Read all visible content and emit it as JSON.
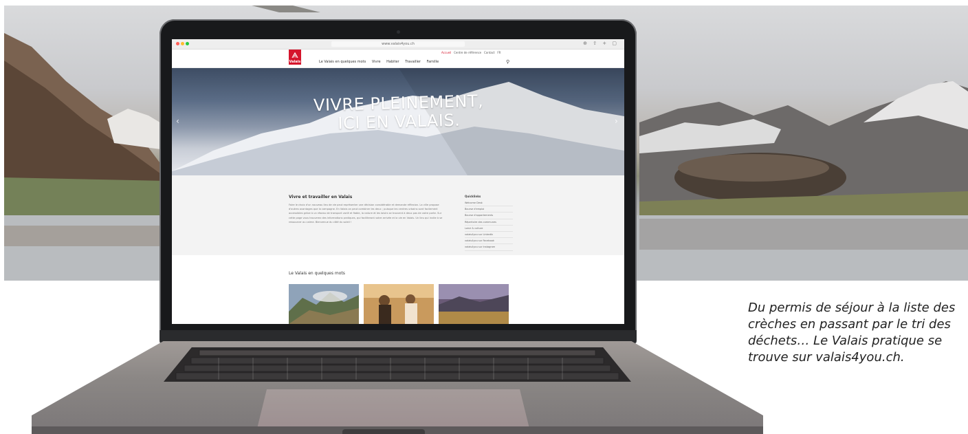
{
  "caption": {
    "text": "Du permis de séjour à la liste des\ncrèches en passant par le tri des\ndéchets… Le Valais pratique se\ntrouve sur valais4you.ch."
  },
  "browser": {
    "url": "www.valais4you.ch"
  },
  "site": {
    "logo_text": "Valais",
    "util_links": [
      "Accueil",
      "Centre de référence",
      "Contact",
      "FR"
    ],
    "nav": [
      "Le Valais en quelques mots",
      "Vivre",
      "Habiter",
      "Travailler",
      "Famille"
    ],
    "hero_title": "VIVRE PLEINEMENT,\nICI EN VALAIS.",
    "intro_heading": "Vivre et travailler en Valais",
    "intro_text": "Faire le choix d'un nouveau lieu de vie peut représenter une décision considérable et demande réflexion. La ville propose d'autres avantages que la campagne. En Valais on peut combiner les deux ; puisque les centres urbains sont facilement accessibles grâce à un réseau de transport varié et fiable, la nature et les loisirs se trouvent à deux pas de votre porte. Sur cette page vous trouverez des informations pratiques, qui faciliteront votre arrivée et la vie en Valais. Un lieu qui invite à se ressourcer au calme. Bienvenue du côté du soleil !",
    "quicklinks_title": "Quicklinks",
    "quicklinks": [
      "Welcome Desk",
      "Bourse d'emploi",
      "Bourse d'appartements",
      "Répertoire des communes",
      "Loisir & culture",
      "valais4you sur LinkedIn",
      "valais4you sur Facebook",
      "valais4you sur Instagram"
    ],
    "section_heading": "Le Valais en quelques mots"
  },
  "colors": {
    "accent": "#d5152c"
  }
}
